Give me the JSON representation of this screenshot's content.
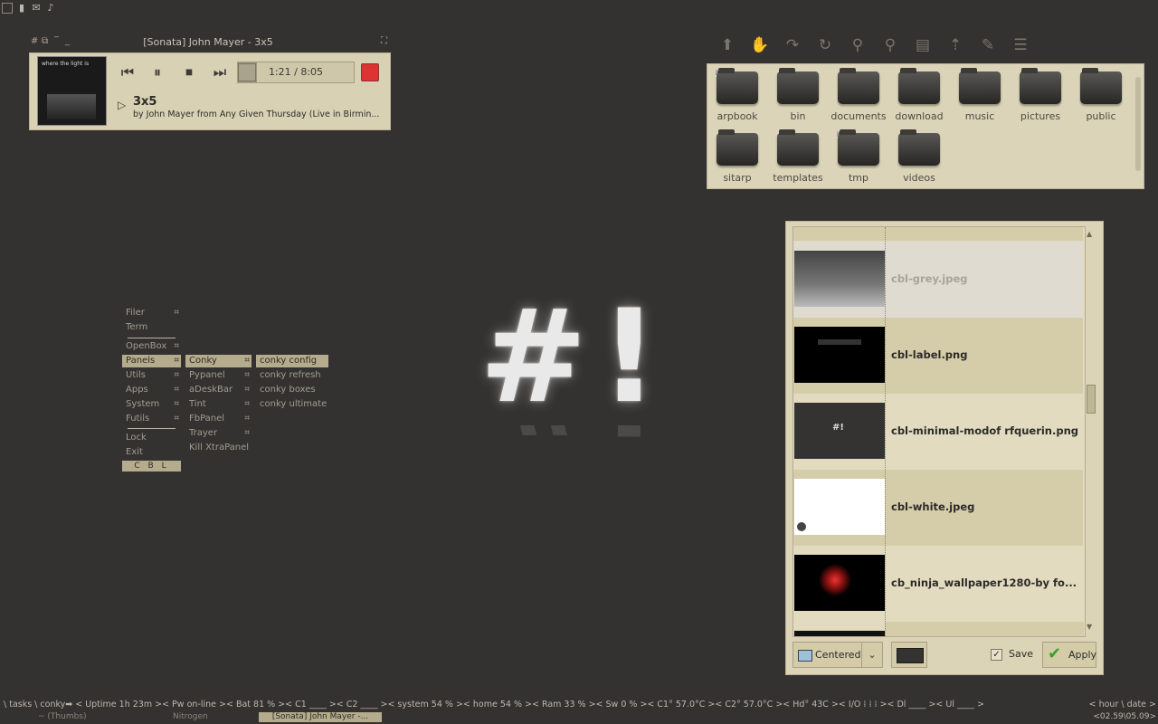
{
  "tray": {
    "icons": [
      "window-icon",
      "signal-icon",
      "mail-icon",
      "music-note-icon"
    ]
  },
  "sonata": {
    "window_title": "[Sonata] John Mayer - 3x5",
    "album_art_text": "where the light is",
    "time": "1:21 / 8:05",
    "progress": 0.167,
    "song_title": "3x5",
    "song_info": "by John Mayer from Any Given Thursday (Live in Birmin..."
  },
  "file_manager": {
    "folders_row1": [
      "arpbook",
      "bin",
      "documents",
      "download",
      "music",
      "pictures",
      "public"
    ],
    "folders_row2": [
      "sitarp",
      "templates",
      "tmp",
      "videos"
    ]
  },
  "menu": {
    "main": [
      "Filer",
      "Term",
      "OpenBox",
      "Panels",
      "Utils",
      "Apps",
      "System",
      "Futils",
      "Lock",
      "Exit"
    ],
    "cbl": "C B L",
    "panels": [
      "Conky",
      "Pypanel",
      "aDeskBar",
      "Tint",
      "FbPanel",
      "Trayer",
      "Kill XtraPanel"
    ],
    "conky": [
      "conky config",
      "conky refresh",
      "conky boxes",
      "conky ultimate"
    ],
    "submenu_marker": "⌗"
  },
  "logo": "#!",
  "nitrogen": {
    "files": [
      "cbl-grey.jpeg",
      "cbl-label.png",
      "cbl-minimal-modof rfquerin.png",
      "cbl-white.jpeg",
      "cb_ninja_wallpaper1280-by fo..."
    ],
    "mode": "Centered",
    "save_label": "Save",
    "save_checked": true,
    "apply_label": "Apply",
    "bg_color": "#353331"
  },
  "conky_bar": {
    "left": "\\ tasks \\ conky➡ < Uptime 1h 23m >< Pw on-line >< Bat 81 % >< C1 ____ >< C2 ____ >< system 54 % >< home 54 % >< Ram 33 % >< Sw 0 % >< C1° 57.0°C >< C2° 57.0°C >< Hd° 43C >< I/O ⁞ ⁞ ⁞ >< Dl ____ >< Ul ____ >",
    "right": "< hour \\ date >"
  },
  "taskbar": {
    "tasks": [
      "~ (Thumbs)",
      "Nitrogen",
      "[Sonata] John Mayer -..."
    ],
    "clock": "<02.59\\05.09>"
  }
}
